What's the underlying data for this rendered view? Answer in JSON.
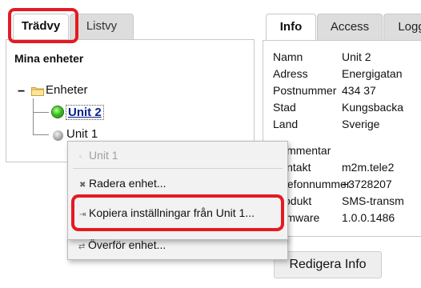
{
  "left_tabs": [
    {
      "label": "Trädvy",
      "active": true
    },
    {
      "label": "Listvy",
      "active": false
    }
  ],
  "left_panel": {
    "title": "Mina enheter",
    "tree": {
      "collapse_symbol": "−",
      "root_label": "Enheter",
      "units": [
        {
          "label": "Unit 2",
          "status": "online",
          "selected": true
        },
        {
          "label": "Unit 1",
          "status": "offline",
          "selected": false
        }
      ]
    }
  },
  "right_tabs": [
    {
      "label": "Info",
      "active": true
    },
    {
      "label": "Access",
      "active": false
    },
    {
      "label": "Logg",
      "active": false
    }
  ],
  "info": {
    "fields": [
      {
        "label": "Namn",
        "value": "Unit 2"
      },
      {
        "label": "Adress",
        "value": "Energigatan"
      },
      {
        "label": "Postnummer",
        "value": "434 37"
      },
      {
        "label": "Stad",
        "value": "Kungsbacka"
      },
      {
        "label": "Land",
        "value": "Sverige"
      },
      {
        "label": "Kommentar",
        "value": ""
      },
      {
        "label": "Kontakt",
        "value": "m2m.tele2"
      },
      {
        "label": "Telefonnummer",
        "value": "+3728207"
      },
      {
        "label": "Produkt",
        "value": "SMS-transm"
      },
      {
        "label": "Firmware",
        "value": "1.0.0.1486"
      }
    ],
    "edit_button": "Redigera Info"
  },
  "context_menu": {
    "header": "Unit 1",
    "items": [
      {
        "label": "Radera enhet...",
        "icon": "delete-x-icon"
      },
      {
        "label": "Kopiera inställningar från Unit 1...",
        "icon": "copy-arrow-icon"
      },
      {
        "label": "Överför enhet...",
        "icon": "transfer-arrows-icon"
      }
    ]
  },
  "colors": {
    "highlight": "#e31b23",
    "link": "#0a1f8f",
    "tab_inactive": "#dddddd",
    "online": "#39c21d"
  }
}
